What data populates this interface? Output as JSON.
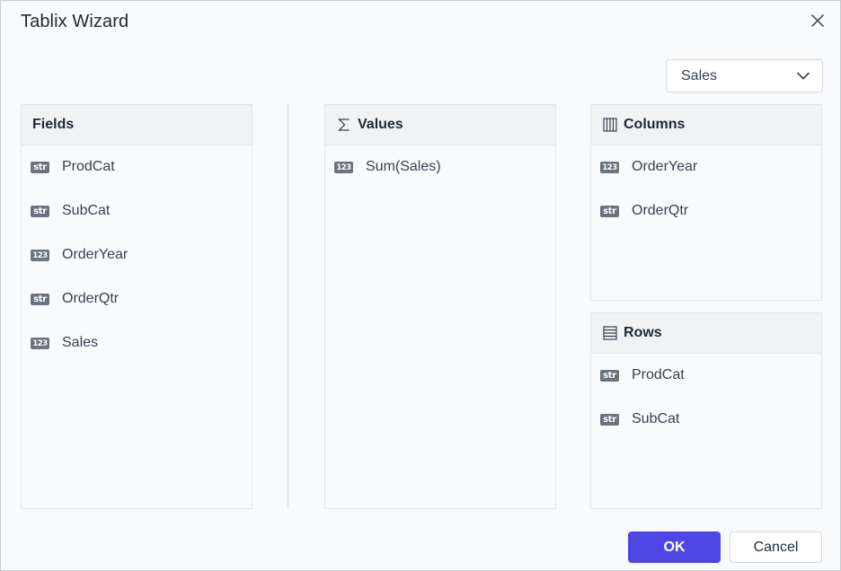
{
  "dialog": {
    "title": "Tablix Wizard",
    "close_icon": "close-icon"
  },
  "dropdown": {
    "selected": "Sales",
    "icon": "chevron-down-icon"
  },
  "fields": {
    "header": "Fields",
    "items": [
      {
        "type": "str",
        "label": "ProdCat"
      },
      {
        "type": "str",
        "label": "SubCat"
      },
      {
        "type": "123",
        "label": "OrderYear"
      },
      {
        "type": "str",
        "label": "OrderQtr"
      },
      {
        "type": "123",
        "label": "Sales"
      }
    ]
  },
  "values": {
    "header": "Values",
    "icon": "sigma-icon",
    "items": [
      {
        "type": "123",
        "label": "Sum(Sales)"
      }
    ]
  },
  "columns": {
    "header": "Columns",
    "icon": "columns-icon",
    "items": [
      {
        "type": "123",
        "label": "OrderYear"
      },
      {
        "type": "str",
        "label": "OrderQtr"
      }
    ]
  },
  "rows": {
    "header": "Rows",
    "icon": "rows-icon",
    "items": [
      {
        "type": "str",
        "label": "ProdCat"
      },
      {
        "type": "str",
        "label": "SubCat"
      }
    ]
  },
  "buttons": {
    "ok": "OK",
    "cancel": "Cancel"
  },
  "colors": {
    "primary": "#4f46e5",
    "badge": "#6b7280",
    "panel_header": "#f1f2f4"
  }
}
